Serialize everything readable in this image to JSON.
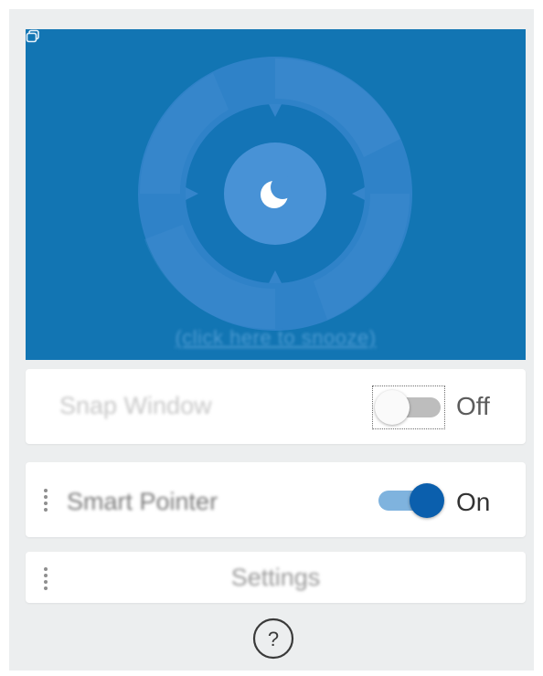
{
  "hero": {
    "snooze_link": "(click here to snooze)",
    "moon_icon": "moon-icon",
    "window_icon": "window-restore-icon",
    "colors": {
      "background": "#1275b3",
      "rings": "#3a8ad0",
      "center": "#4c98d8"
    }
  },
  "snap_window": {
    "label": "Snap Window",
    "toggle_state": "Off",
    "enabled": false
  },
  "smart_pointer": {
    "label": "Smart Pointer",
    "toggle_state": "On",
    "enabled": true,
    "drag_icon": "drag-handle-icon"
  },
  "settings": {
    "label": "Settings",
    "drag_icon": "drag-handle-icon"
  },
  "help": {
    "icon": "help-question-icon",
    "glyph": "?"
  },
  "colors": {
    "accent": "#0b5fad",
    "accent_track": "#7fb3de",
    "panel_bg": "#eceeef"
  }
}
